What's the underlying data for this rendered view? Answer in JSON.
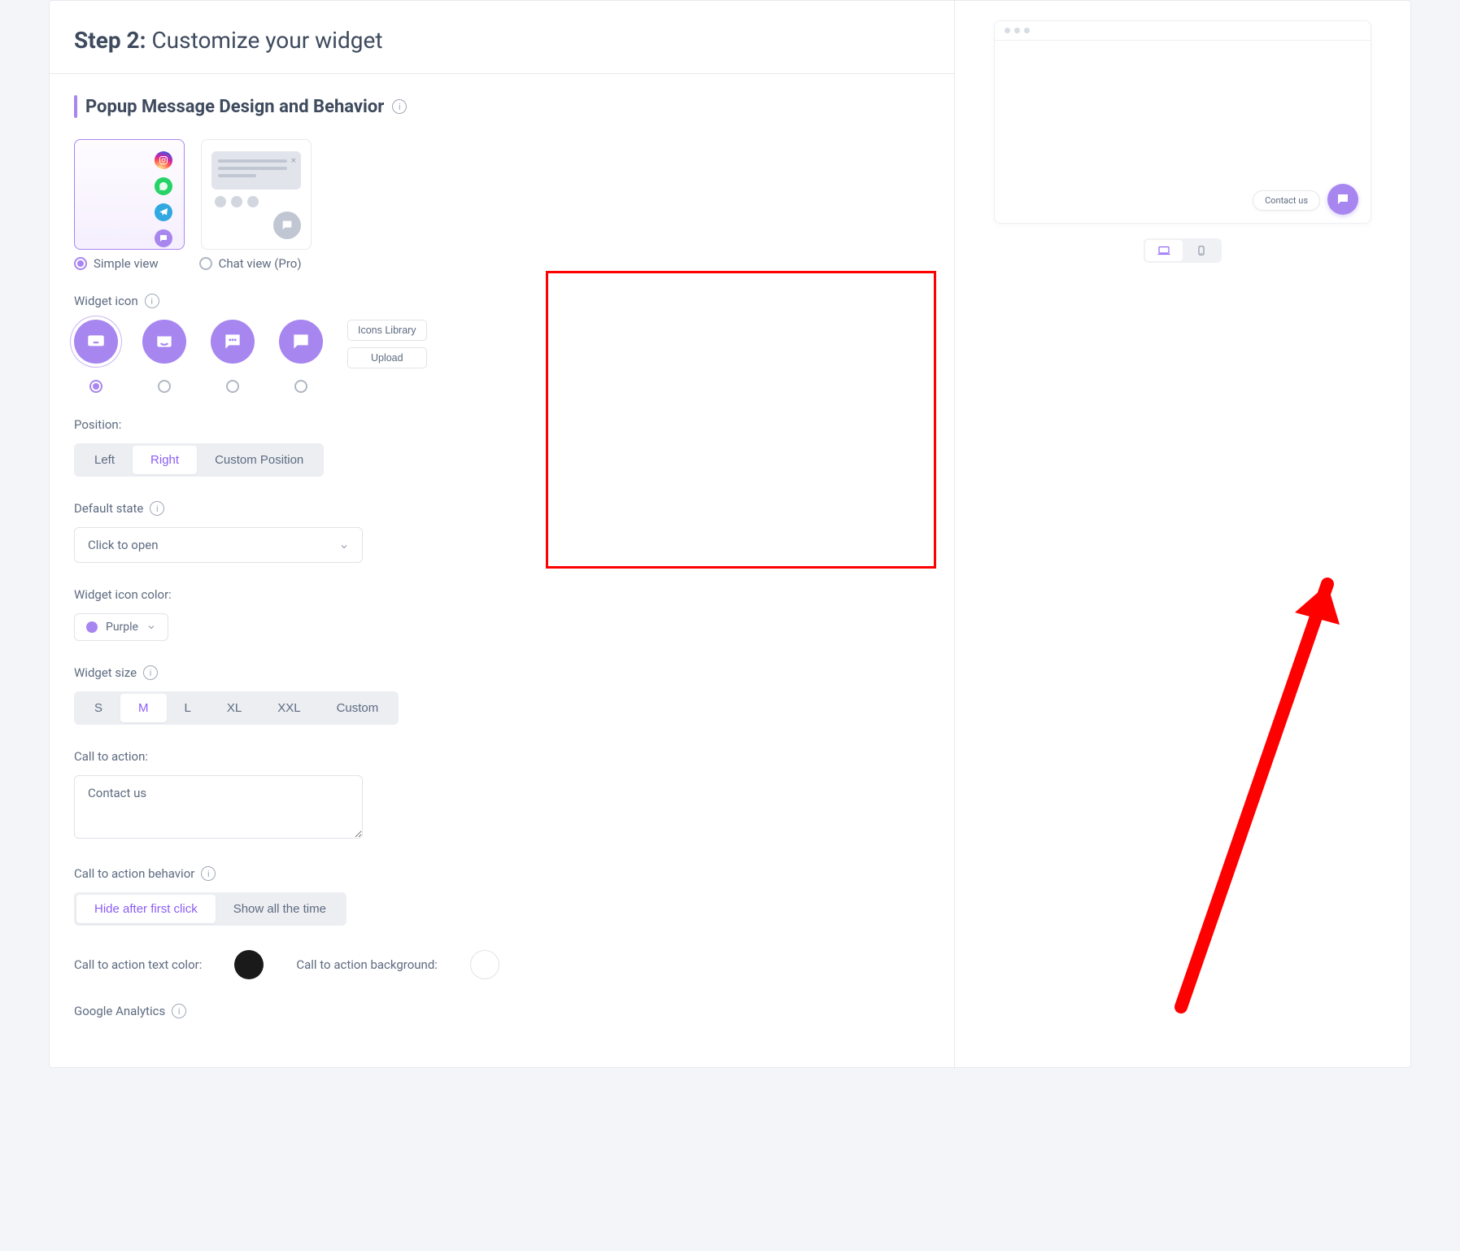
{
  "step": {
    "number_label": "Step 2:",
    "title": "Customize your widget"
  },
  "section": {
    "title": "Popup Message Design and Behavior"
  },
  "design": {
    "simple_label": "Simple view",
    "chat_label": "Chat view (Pro)"
  },
  "widget_icon": {
    "label": "Widget icon",
    "library_btn": "Icons Library",
    "upload_btn": "Upload"
  },
  "position": {
    "label": "Position:",
    "left": "Left",
    "right": "Right",
    "custom": "Custom Position"
  },
  "default_state": {
    "label": "Default state",
    "value": "Click to open"
  },
  "icon_color": {
    "label": "Widget icon color:",
    "value": "Purple"
  },
  "size": {
    "label": "Widget size",
    "options": [
      "S",
      "M",
      "L",
      "XL",
      "XXL",
      "Custom"
    ]
  },
  "cta": {
    "label": "Call to action:",
    "value": "Contact us"
  },
  "cta_behavior": {
    "label": "Call to action behavior",
    "hide": "Hide after first click",
    "show": "Show all the time"
  },
  "cta_colors": {
    "text_label": "Call to action text color:",
    "bg_label": "Call to action background:",
    "text_value": "#1a1a1a",
    "bg_value": "#ffffff"
  },
  "analytics": {
    "label": "Google Analytics"
  },
  "preview": {
    "cta_text": "Contact us"
  }
}
